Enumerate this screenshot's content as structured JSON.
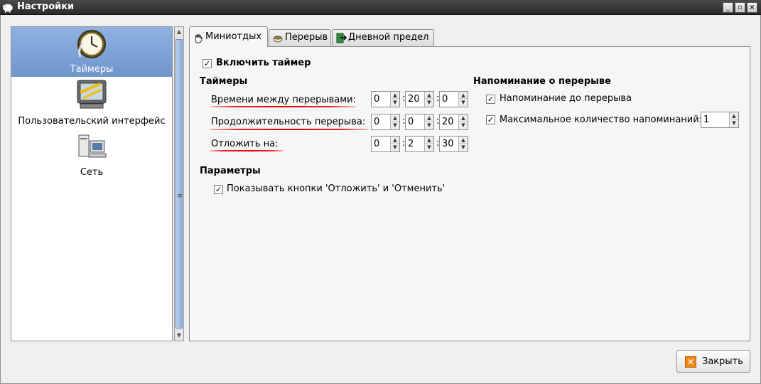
{
  "window": {
    "title": "Настройки",
    "controls": [
      "_",
      "▫",
      "×"
    ]
  },
  "sidebar": {
    "items": [
      {
        "label": "Таймеры",
        "icon": "clock-icon",
        "selected": true
      },
      {
        "label": "Пользовательский интерфейс",
        "icon": "monitor-icon",
        "selected": false
      },
      {
        "label": "Сеть",
        "icon": "network-icon",
        "selected": false
      }
    ]
  },
  "tabs": [
    {
      "label": "Миниотдых",
      "icon": "hand-icon",
      "active": true
    },
    {
      "label": "Перерыв",
      "icon": "coffee-cup-icon",
      "active": false
    },
    {
      "label": "Дневной предел",
      "icon": "exit-icon",
      "active": false
    }
  ],
  "main": {
    "enable_timer": {
      "label": "Включить таймер",
      "checked": true
    },
    "timers_heading": "Таймеры",
    "timers": [
      {
        "label": "Времени между перерывами:",
        "values": [
          "0",
          "20",
          "0"
        ]
      },
      {
        "label": "Продолжительность перерыва:",
        "values": [
          "0",
          "0",
          "20"
        ]
      },
      {
        "label": "Отложить на:",
        "values": [
          "0",
          "2",
          "30"
        ]
      }
    ],
    "reminder_heading": "Напоминание о перерыве",
    "reminder_before": {
      "label": "Напоминание до перерыва",
      "checked": true
    },
    "max_reminders": {
      "label": "Максимальное количество напоминаний:",
      "checked": true,
      "value": "1"
    },
    "params_heading": "Параметры",
    "show_buttons": {
      "label": "Показывать кнопки 'Отложить' и 'Отменить'",
      "checked": true
    },
    "colon": ":"
  },
  "footer": {
    "close_label": "Закрыть"
  },
  "colors": {
    "selection": "#7a9fd6",
    "annotation_red": "#e00000",
    "titlebar": "#3a3a3a"
  }
}
